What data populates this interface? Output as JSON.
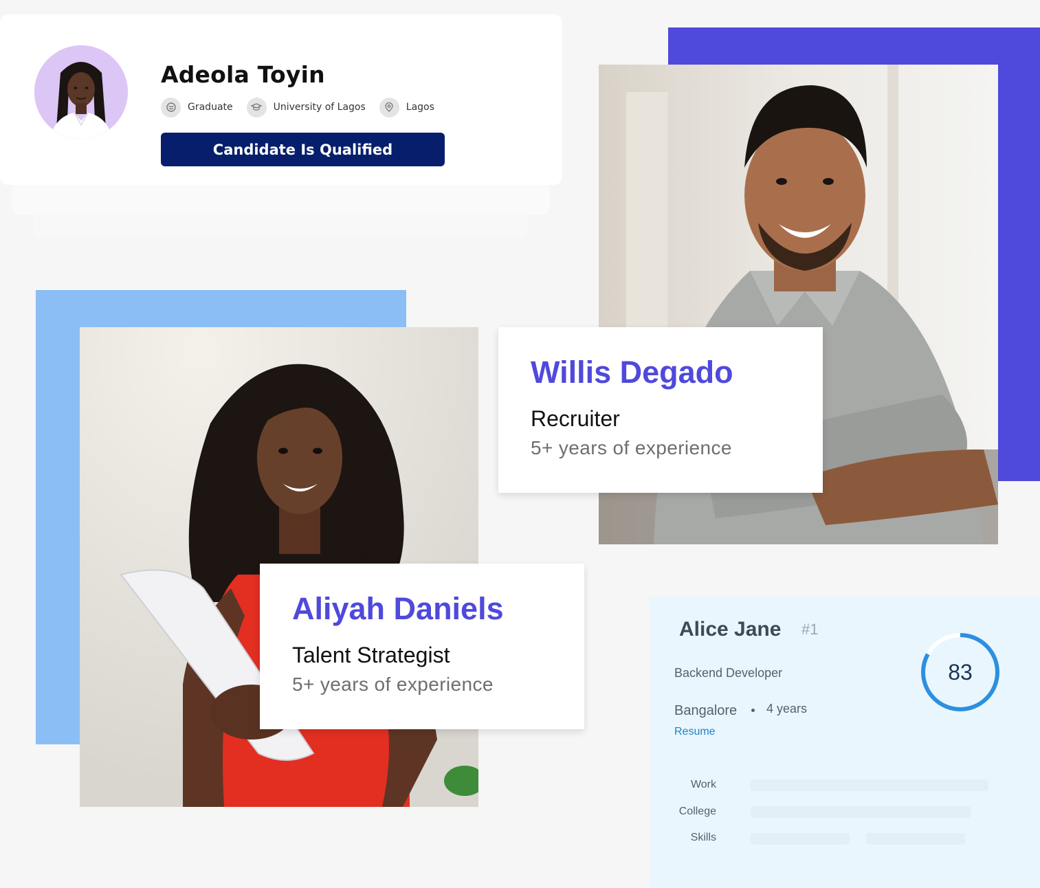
{
  "candidate": {
    "name": "Adeola Toyin",
    "meta": [
      {
        "icon": "graduate-icon",
        "label": "Graduate"
      },
      {
        "icon": "mortarboard-icon",
        "label": "University of Lagos"
      },
      {
        "icon": "location-pin-icon",
        "label": "Lagos"
      }
    ],
    "status_button": "Candidate Is Qualified"
  },
  "profiles": [
    {
      "name": "Willis Degado",
      "role": "Recruiter",
      "experience": "5+ years of experience"
    },
    {
      "name": "Aliyah Daniels",
      "role": "Talent Strategist",
      "experience": "5+ years of experience"
    }
  ],
  "ranking": {
    "name": "Alice Jane",
    "rank": "#1",
    "role": "Backend Developer",
    "city": "Bangalore",
    "experience": "4 years",
    "resume_link": "Resume",
    "score": "83",
    "score_fraction": 0.83,
    "rows": [
      {
        "label": "Work"
      },
      {
        "label": "College"
      },
      {
        "label": "Skills"
      }
    ]
  },
  "colors": {
    "accent_purple": "#4f49dc",
    "accent_blue": "#8bbef5",
    "button_navy": "#061e6b",
    "score_ring": "#2d8fe0",
    "panel_bg": "#e9f6fd"
  }
}
